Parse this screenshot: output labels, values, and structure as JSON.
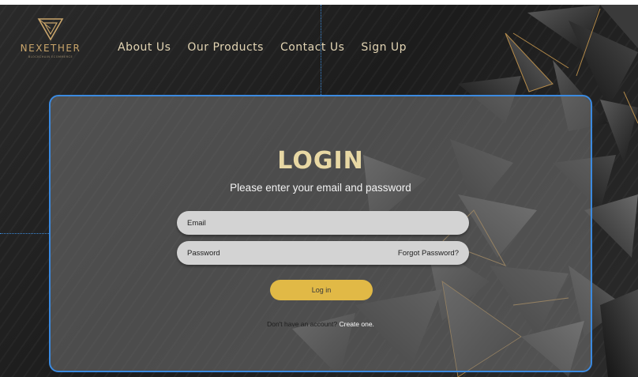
{
  "brand": {
    "name": "NEXETHER",
    "tagline": "BLOCKCHAIN ECOMMERCE",
    "accent": "#c9a56b"
  },
  "nav": {
    "items": [
      {
        "label": "About Us"
      },
      {
        "label": "Our Products"
      },
      {
        "label": "Contact Us"
      },
      {
        "label": "Sign Up"
      }
    ]
  },
  "login": {
    "title": "LOGIN",
    "subtitle": "Please enter your email and password",
    "email_label": "Email",
    "password_label": "Password",
    "forgot_label": "Forgot Password?",
    "button_label": "Log in",
    "signup_prompt": "Don't have an account?",
    "signup_link": "Create one.",
    "button_color": "#e1b946",
    "title_color": "#e8d8a4"
  },
  "icons": {
    "logo": "triangle-logo-icon"
  }
}
